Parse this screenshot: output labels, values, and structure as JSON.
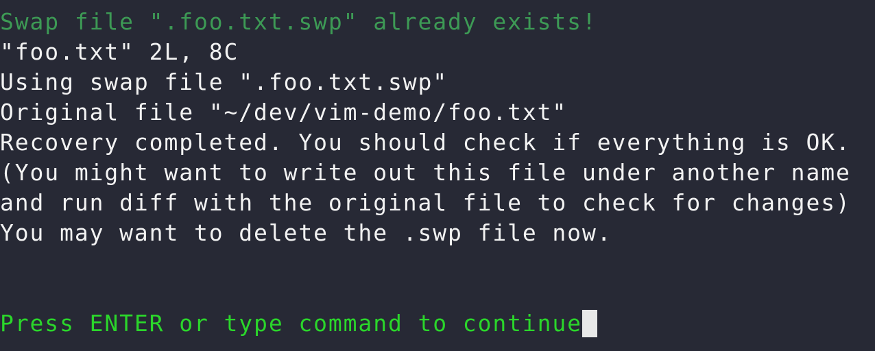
{
  "terminal": {
    "warning_line": "Swap file \".foo.txt.swp\" already exists!",
    "output_lines": [
      "\"foo.txt\" 2L, 8C",
      "Using swap file \".foo.txt.swp\"",
      "Original file \"~/dev/vim-demo/foo.txt\"",
      "Recovery completed. You should check if everything is OK.",
      "(You might want to write out this file under another name",
      "and run diff with the original file to check for changes)",
      "You may want to delete the .swp file now."
    ],
    "prompt_line": "Press ENTER or type command to continue"
  },
  "colors": {
    "background": "#272935",
    "text": "#f2f2f2",
    "warning": "#3d9a55",
    "prompt": "#2bd62b",
    "cursor": "#e8e8e8"
  }
}
